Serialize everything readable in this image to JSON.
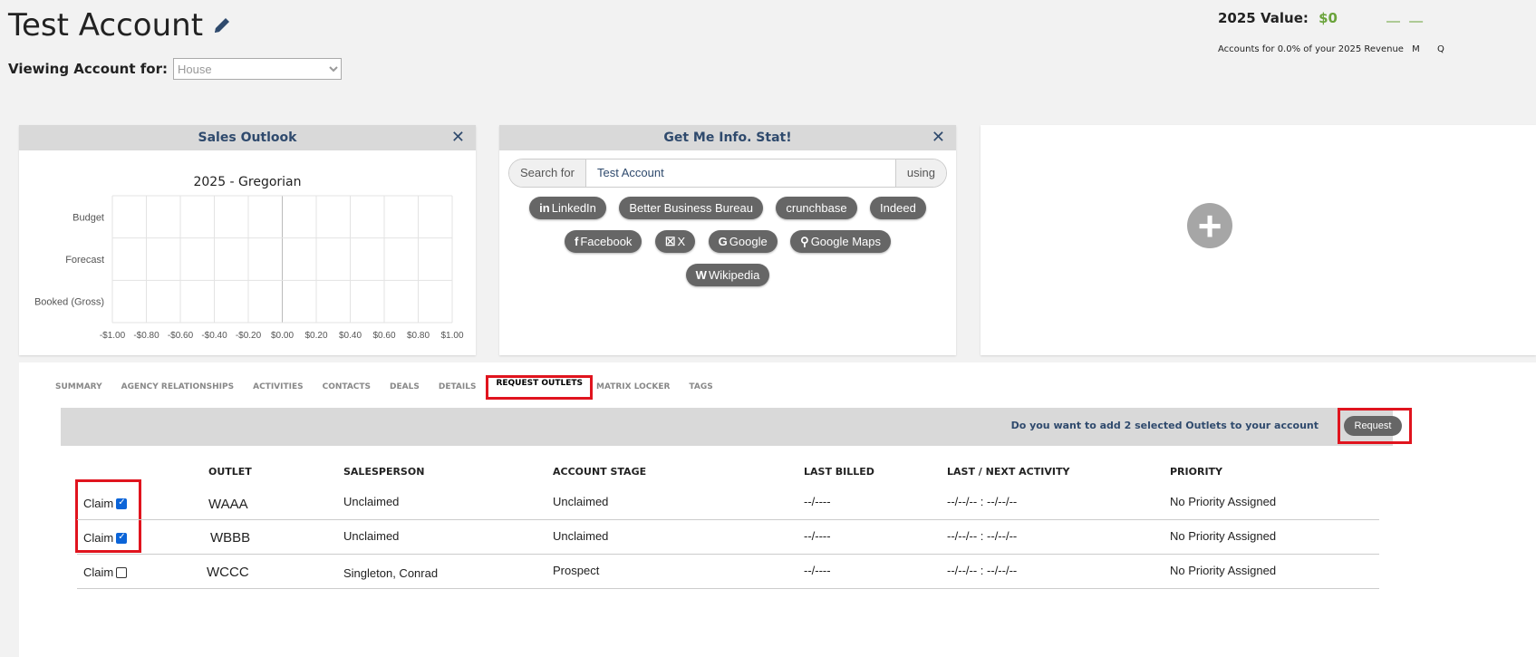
{
  "header": {
    "title": "Test Account",
    "viewing_label": "Viewing Account for:",
    "viewing_value": "House",
    "value_label": "2025 Value:",
    "value_amount": "$0",
    "revenue_note": "Accounts for 0.0% of your 2025 Revenue",
    "period_buttons": [
      "M",
      "Q"
    ]
  },
  "sales_outlook": {
    "title": "Sales Outlook"
  },
  "chart_data": {
    "type": "bar",
    "title": "2025 - Gregorian",
    "categories": [
      "Budget",
      "Forecast",
      "Booked (Gross)"
    ],
    "values": [
      0,
      0,
      0
    ],
    "xticks": [
      "-$1.00",
      "-$0.80",
      "-$0.60",
      "-$0.40",
      "-$0.20",
      "$0.00",
      "$0.20",
      "$0.40",
      "$0.60",
      "$0.80",
      "$1.00"
    ],
    "xlim": [
      -1,
      1
    ],
    "grid": true
  },
  "info": {
    "title": "Get Me Info. Stat!",
    "search_label": "Search for",
    "search_value": "Test Account",
    "using_label": "using",
    "row1": [
      "LinkedIn",
      "Better Business Bureau",
      "crunchbase",
      "Indeed"
    ],
    "row2": [
      "Facebook",
      "X",
      "Google",
      "Google Maps"
    ],
    "row3": [
      "Wikipedia"
    ]
  },
  "tabs": [
    "SUMMARY",
    "AGENCY RELATIONSHIPS",
    "ACTIVITIES",
    "CONTACTS",
    "DEALS",
    "DETAILS",
    "REQUEST OUTLETS",
    "MATRIX LOCKER",
    "TAGS"
  ],
  "request_bar": {
    "text": "Do you want to add 2 selected Outlets to your account",
    "button": "Request"
  },
  "table": {
    "headers": [
      "OUTLET",
      "SALESPERSON",
      "ACCOUNT STAGE",
      "LAST BILLED",
      "LAST / NEXT ACTIVITY",
      "PRIORITY"
    ],
    "claim_label": "Claim",
    "rows": [
      {
        "checked": true,
        "outlet": "WAAA",
        "salesperson": "Unclaimed",
        "stage": "Unclaimed",
        "billed": "--/----",
        "activity": "--/--/-- : --/--/--",
        "priority": "No Priority Assigned"
      },
      {
        "checked": true,
        "outlet": "WBBB",
        "salesperson": "Unclaimed",
        "stage": "Unclaimed",
        "billed": "--/----",
        "activity": "--/--/-- : --/--/--",
        "priority": "No Priority Assigned"
      },
      {
        "checked": false,
        "outlet": "WCCC",
        "salesperson": "Singleton, Conrad",
        "stage": "Prospect",
        "billed": "--/----",
        "activity": "--/--/-- : --/--/--",
        "priority": "No Priority Assigned"
      }
    ]
  }
}
